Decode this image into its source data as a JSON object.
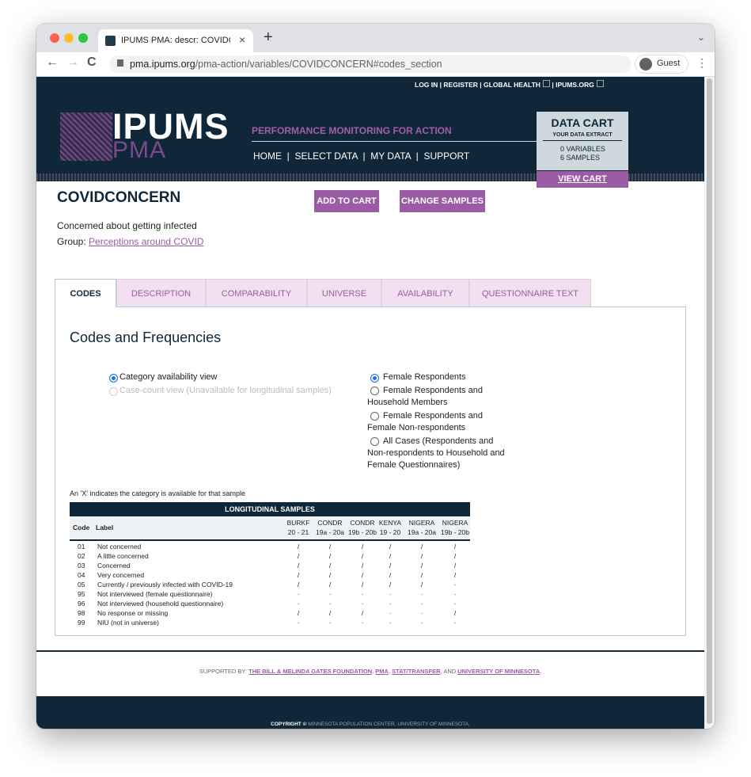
{
  "browser": {
    "tab_title": "IPUMS PMA: descr: COVIDCO",
    "tab_close": "×",
    "new_tab": "+",
    "url_host": "pma.ipums.org",
    "url_path": "/pma-action/variables/COVIDCONCERN#codes_section",
    "profile_label": "Guest",
    "back": "←",
    "forward": "→",
    "reload": "C",
    "menu": "⋮",
    "tab_menu": "⌄"
  },
  "topbar": {
    "login": "LOG IN",
    "register": "REGISTER",
    "global_health": "GLOBAL HEALTH",
    "ipums_org": "IPUMS.ORG",
    "sep": "|"
  },
  "header": {
    "logo_ipums": "IPUMS",
    "logo_pma": "PMA",
    "tagline": "PERFORMANCE MONITORING FOR ACTION",
    "nav": [
      "HOME",
      "SELECT DATA",
      "MY DATA",
      "SUPPORT"
    ],
    "nav_sep": "|"
  },
  "cart": {
    "title": "DATA CART",
    "subtitle": "YOUR DATA EXTRACT",
    "variables": "0  VARIABLES",
    "samples": "6  SAMPLES",
    "view_cart": "VIEW CART"
  },
  "variable": {
    "name": "COVIDCONCERN",
    "add_to_cart": "ADD TO CART",
    "change_samples": "CHANGE SAMPLES",
    "description": "Concerned about getting infected",
    "group_label": "Group:",
    "group_link": "Perceptions around COVID"
  },
  "tabs": [
    "CODES",
    "DESCRIPTION",
    "COMPARABILITY",
    "UNIVERSE",
    "AVAILABILITY",
    "QUESTIONNAIRE TEXT"
  ],
  "codes": {
    "title": "Codes and Frequencies",
    "view_options": [
      {
        "label": "Category availability view",
        "checked": true,
        "disabled": false
      },
      {
        "label": "Case-count view (Unavailable for longitudinal samples)",
        "checked": false,
        "disabled": true
      }
    ],
    "universe_options": [
      {
        "line1": "Female Respondents",
        "line2": "",
        "line3": "",
        "checked": true
      },
      {
        "line1": "Female Respondents and",
        "line2": "Household Members",
        "line3": "",
        "checked": false
      },
      {
        "line1": "Female Respondents and",
        "line2": "Female Non-respondents",
        "line3": "",
        "checked": false
      },
      {
        "line1": "All Cases (Respondents and",
        "line2": "Non-respondents to Household and",
        "line3": "Female Questionnaires)",
        "checked": false
      }
    ],
    "note": "An 'X' indicates the category is available for that sample",
    "table_title": "LONGITUDINAL SAMPLES",
    "col_code": "Code",
    "col_label": "Label",
    "samples": [
      {
        "top": "BURKF",
        "bottom": "20 - 21"
      },
      {
        "top": "CONDR",
        "bottom": "19a - 20a"
      },
      {
        "top": "CONDR",
        "bottom": "19b - 20b"
      },
      {
        "top": "KENYA",
        "bottom": "19 - 20"
      },
      {
        "top": "NIGERA",
        "bottom": "19a - 20a"
      },
      {
        "top": "NIGERA",
        "bottom": "19b - 20b"
      }
    ],
    "rows": [
      {
        "code": "01",
        "label": "Not concerned",
        "marks": [
          "/",
          "/",
          "/",
          "/",
          "/",
          "/"
        ]
      },
      {
        "code": "02",
        "label": "A little concerned",
        "marks": [
          "/",
          "/",
          "/",
          "/",
          "/",
          "/"
        ]
      },
      {
        "code": "03",
        "label": "Concerned",
        "marks": [
          "/",
          "/",
          "/",
          "/",
          "/",
          "/"
        ]
      },
      {
        "code": "04",
        "label": "Very concerned",
        "marks": [
          "/",
          "/",
          "/",
          "/",
          "/",
          "/"
        ]
      },
      {
        "code": "05",
        "label": "Currently / previously infected with COVID-19",
        "marks": [
          "/",
          "/",
          "/",
          "/",
          "/",
          "·"
        ]
      },
      {
        "code": "95",
        "label": "Not interviewed (female questionnaire)",
        "marks": [
          "·",
          "·",
          "·",
          "·",
          "·",
          "·"
        ]
      },
      {
        "code": "96",
        "label": "Not interviewed (household questionnaire)",
        "marks": [
          "·",
          "·",
          "·",
          "·",
          "·",
          "·"
        ]
      },
      {
        "code": "98",
        "label": "No response or missing",
        "marks": [
          "/",
          "/",
          "/",
          "·",
          "·",
          "/"
        ]
      },
      {
        "code": "99",
        "label": "NIU (not in universe)",
        "marks": [
          "·",
          "·",
          "·",
          "·",
          "·",
          "·"
        ]
      }
    ]
  },
  "footer": {
    "supported_by": "SUPPORTED BY:",
    "sponsor1": "THE BILL & MELINDA GATES FOUNDATION",
    "sponsor2": "PMA",
    "sponsor3": "STAT/TRANSFER",
    "and": "AND",
    "sponsor4": "UNIVERSITY OF MINNESOTA",
    "comma": ",",
    "period": ".",
    "copyright": "COPYRIGHT ©",
    "copyright_text": "MINNESOTA POPULATION CENTER, UNIVERSITY OF MINNESOTA."
  },
  "colors": {
    "navy": "#0f2738",
    "purple": "#9b5ba5",
    "tab_pink": "#f2dff0",
    "traffic_red": "#ff5f57",
    "traffic_yellow": "#febc2e",
    "traffic_green": "#28c840"
  }
}
